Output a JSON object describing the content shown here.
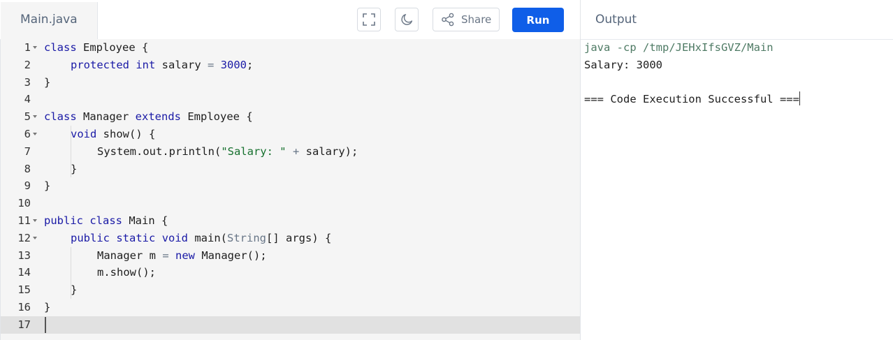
{
  "editor": {
    "file_tab": "Main.java",
    "lines": [
      {
        "n": "1",
        "fold": true
      },
      {
        "n": "2",
        "fold": false
      },
      {
        "n": "3",
        "fold": false
      },
      {
        "n": "4",
        "fold": false
      },
      {
        "n": "5",
        "fold": true
      },
      {
        "n": "6",
        "fold": true
      },
      {
        "n": "7",
        "fold": false
      },
      {
        "n": "8",
        "fold": false
      },
      {
        "n": "9",
        "fold": false
      },
      {
        "n": "10",
        "fold": false
      },
      {
        "n": "11",
        "fold": true
      },
      {
        "n": "12",
        "fold": true
      },
      {
        "n": "13",
        "fold": false
      },
      {
        "n": "14",
        "fold": false
      },
      {
        "n": "15",
        "fold": false
      },
      {
        "n": "16",
        "fold": false
      },
      {
        "n": "17",
        "fold": false
      }
    ],
    "code": {
      "l1": {
        "k": "class",
        "t": " Employee {"
      },
      "l2": {
        "k1": "protected",
        "sp": " ",
        "k2": "int",
        "t": " salary ",
        "op": "=",
        "sp2": " ",
        "num": "3000",
        "end": ";"
      },
      "l3": {
        "t": "}"
      },
      "l5": {
        "k": "class",
        "t": " Manager ",
        "k2": "extends",
        "t2": " Employee {"
      },
      "l6": {
        "k": "void",
        "t": " show() {"
      },
      "l7": {
        "t": "System.out.println(",
        "s": "\"Salary: \"",
        "sp": " ",
        "op": "+",
        "t2": " salary);"
      },
      "l8": {
        "t": "}"
      },
      "l9": {
        "t": "}"
      },
      "l11": {
        "k": "public",
        "sp": " ",
        "k2": "class",
        "t": " Main {"
      },
      "l12": {
        "k": "public",
        "sp": " ",
        "k2": "static",
        "sp2": " ",
        "k3": "void",
        "t": " main(",
        "ty": "String",
        "t2": "[] args) {"
      },
      "l13": {
        "t": "Manager m ",
        "op": "=",
        "sp": " ",
        "k": "new",
        "t2": " Manager();"
      },
      "l14": {
        "t": "m.show();"
      },
      "l15": {
        "t": "}"
      },
      "l16": {
        "t": "}"
      }
    }
  },
  "toolbar": {
    "fullscreen_icon": "fullscreen-icon",
    "theme_icon": "moon-icon",
    "share_label": "Share",
    "run_label": "Run"
  },
  "output": {
    "title": "Output",
    "command": "java -cp /tmp/JEHxIfsGVZ/Main",
    "result": "Salary: 3000",
    "status": "=== Code Execution Successful ==="
  },
  "colors": {
    "run_button": "#0f5ee8",
    "keyword": "#1a1aa6",
    "string": "#17712f",
    "editor_bg": "#f5f5f5"
  }
}
